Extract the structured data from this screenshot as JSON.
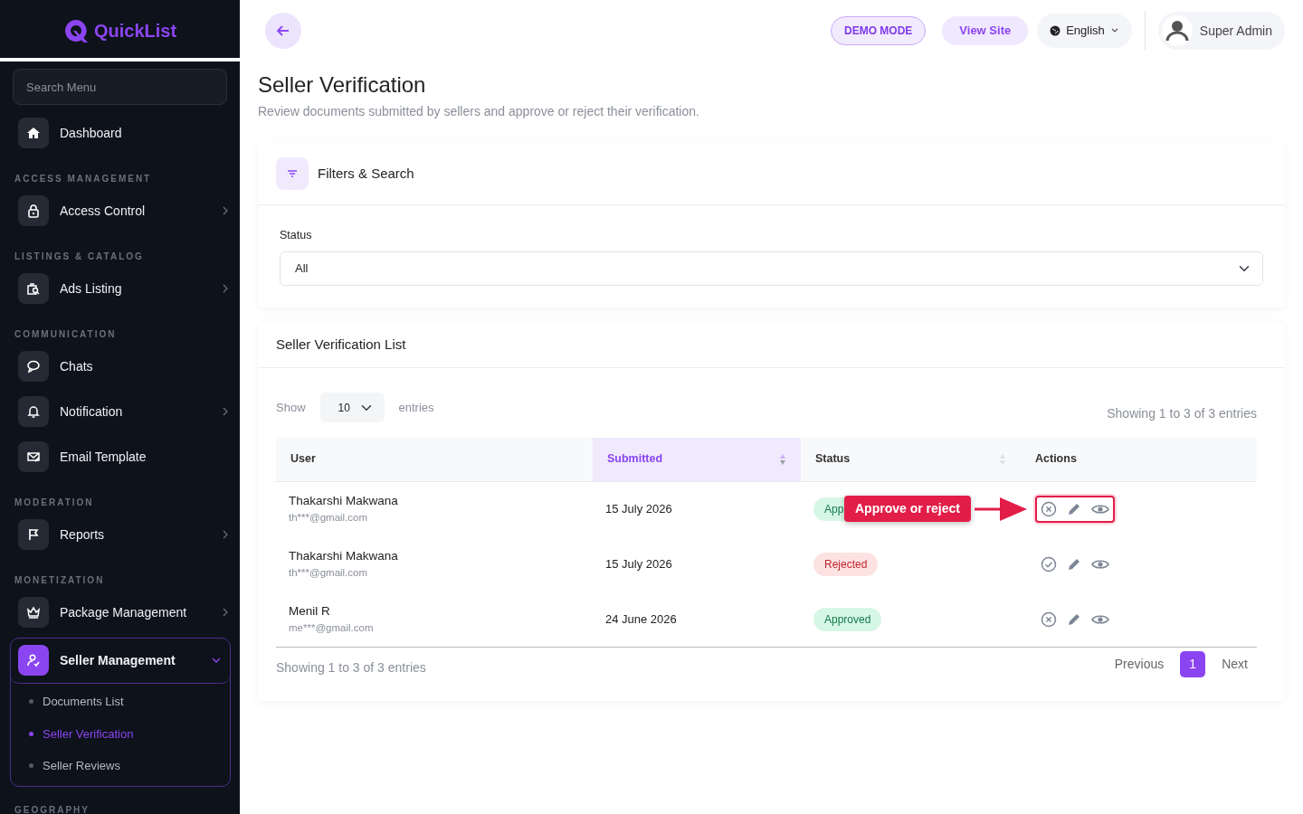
{
  "brand": {
    "name": "QuickList"
  },
  "sidebar": {
    "search": {
      "placeholder": "Search Menu"
    },
    "sections": [
      {
        "items": [
          {
            "label": "Dashboard",
            "arrow": false,
            "expanded": false,
            "selected": false
          }
        ]
      },
      {
        "label": "ACCESS MANAGEMENT",
        "items": [
          {
            "label": "Access Control",
            "arrow": true,
            "expanded": false,
            "selected": false
          }
        ]
      },
      {
        "label": "LISTINGS & CATALOG",
        "items": [
          {
            "label": "Ads Listing",
            "arrow": true,
            "expanded": false,
            "selected": false
          }
        ]
      },
      {
        "label": "COMMUNICATION",
        "items": [
          {
            "label": "Chats",
            "arrow": false,
            "expanded": false,
            "selected": false
          },
          {
            "label": "Notification",
            "arrow": true,
            "expanded": false,
            "selected": false
          },
          {
            "label": "Email Template",
            "arrow": false,
            "expanded": false,
            "selected": false
          }
        ]
      },
      {
        "label": "MODERATION",
        "items": [
          {
            "label": "Reports",
            "arrow": true,
            "expanded": false,
            "selected": false
          }
        ]
      },
      {
        "label": "MONETIZATION",
        "items": [
          {
            "label": "Package Management",
            "arrow": true,
            "expanded": false,
            "selected": false
          },
          {
            "label": "Seller Management",
            "arrow": true,
            "expanded": true,
            "selected": true,
            "children": [
              {
                "label": "Documents List",
                "selected": false
              },
              {
                "label": "Seller Verification",
                "selected": true
              },
              {
                "label": "Seller Reviews",
                "selected": false
              }
            ]
          }
        ]
      },
      {
        "label": "GEOGRAPHY"
      }
    ]
  },
  "topbar": {
    "demo": "DEMO MODE",
    "view_site": "View Site",
    "language": "English",
    "user": "Super Admin"
  },
  "page": {
    "title": "Seller Verification",
    "subtitle": "Review documents submitted by sellers and approve or reject their verification."
  },
  "filters": {
    "title": "Filters & Search",
    "status_label": "Status",
    "status_value": "All"
  },
  "list": {
    "title": "Seller Verification List",
    "show": "Show",
    "page_size": "10",
    "entries": "entries",
    "info_top": "Showing 1 to 3 of 3 entries",
    "info_bottom": "Showing 1 to 3 of 3 entries",
    "columns": [
      {
        "label": "User",
        "sortable": false,
        "sorted": false
      },
      {
        "label": "Submitted",
        "sortable": true,
        "sorted": true
      },
      {
        "label": "Status",
        "sortable": true,
        "sorted": false
      },
      {
        "label": "Actions",
        "sortable": false,
        "sorted": false
      }
    ],
    "rows": [
      {
        "name": "Thakarshi Makwana",
        "email": "th***@gmail.com",
        "submitted": "15 July 2026",
        "status": {
          "label": "App",
          "kind": "approved"
        },
        "callout": "Approve or reject"
      },
      {
        "name": "Thakarshi Makwana",
        "email": "th***@gmail.com",
        "submitted": "15 July 2026",
        "status": {
          "label": "Rejected",
          "kind": "rejected"
        }
      },
      {
        "name": "Menil R",
        "email": "me***@gmail.com",
        "submitted": "24 June 2026",
        "status": {
          "label": "Approved",
          "kind": "approved"
        }
      }
    ],
    "pagination": {
      "previous": "Previous",
      "pages": [
        {
          "label": "1",
          "selected": true
        }
      ],
      "next": "Next"
    }
  }
}
